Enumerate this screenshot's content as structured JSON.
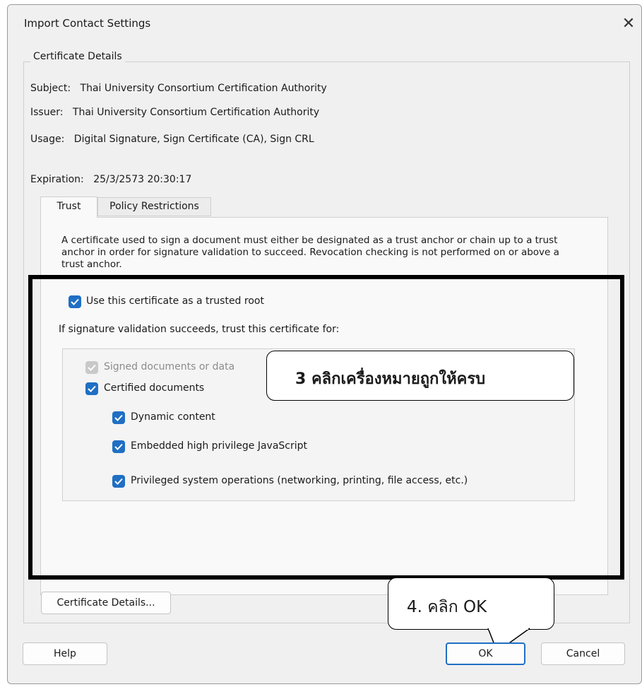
{
  "dialog": {
    "title": "Import Contact Settings"
  },
  "certificate_details": {
    "legend": "Certificate Details",
    "subject_label": "Subject:",
    "subject_value": "Thai University Consortium Certification Authority",
    "issuer_label": "Issuer:",
    "issuer_value": "Thai University Consortium Certification Authority",
    "usage_label": "Usage:",
    "usage_value": "Digital Signature, Sign Certificate (CA), Sign CRL",
    "expiration_label": "Expiration:",
    "expiration_value": "25/3/2573 20:30:17"
  },
  "tabs": [
    {
      "label": "Trust",
      "selected": true
    },
    {
      "label": "Policy Restrictions",
      "selected": false
    }
  ],
  "trust": {
    "description": "A certificate used to sign a document must either be designated as a trust anchor or chain up to a trust anchor in order for signature validation to succeed.  Revocation checking is not performed on or above a trust anchor.",
    "trusted_root_label": "Use this certificate as a trusted root",
    "trust_for_label": "If signature validation succeeds, trust this certificate for:",
    "options": [
      {
        "label": "Signed documents or data",
        "checked": true,
        "disabled": true
      },
      {
        "label": "Certified documents",
        "checked": true,
        "disabled": false
      },
      {
        "label": "Dynamic content",
        "checked": true,
        "disabled": false
      },
      {
        "label": "Embedded high privilege JavaScript",
        "checked": true,
        "disabled": false
      },
      {
        "label": "Privileged system operations (networking, printing, file access, etc.)",
        "checked": true,
        "disabled": false
      }
    ]
  },
  "annotations": {
    "step3": "3 คลิกเครื่องหมายถูกให้ครบ",
    "step4": "4. คลิก OK"
  },
  "buttons": {
    "certificate_details": "Certificate Details...",
    "help": "Help",
    "ok": "OK",
    "cancel": "Cancel"
  },
  "colors": {
    "accent": "#1f6fc4",
    "annotation_border": "#000000"
  }
}
